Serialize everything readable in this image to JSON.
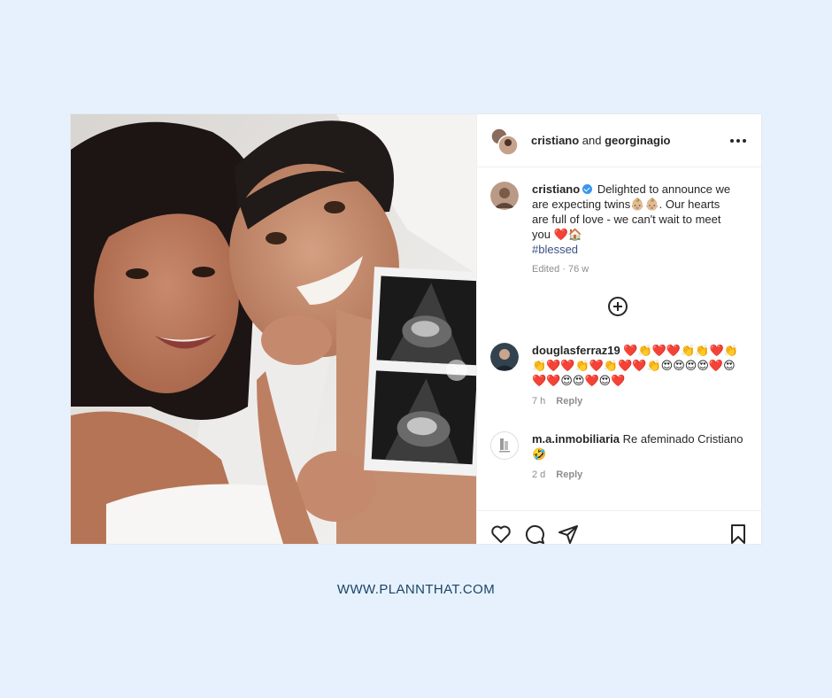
{
  "post": {
    "header": {
      "user1": "cristiano",
      "and": " and ",
      "user2": "georginagio"
    },
    "caption": {
      "username": "cristiano",
      "text": "Delighted to announce we are expecting twins👶🏼👶🏼. Our hearts are full of love - we can't wait to meet you ❤️🏠",
      "hashtag": "#blessed",
      "meta": "Edited · 76 w"
    },
    "comments": [
      {
        "username": "douglasferraz19",
        "text": "❤️👏❤️❤️👏👏❤️👏👏❤️❤️👏❤️👏❤️❤️👏😍😍😍😍❤️😍❤️❤️😍😍❤️😍❤️",
        "time": "7 h",
        "reply": "Reply"
      },
      {
        "username": "m.a.inmobiliaria",
        "text": "Re afeminado Cristiano 🤣",
        "time": "2 d",
        "reply": "Reply"
      }
    ]
  },
  "footer": {
    "url": "WWW.PLANNTHAT.COM"
  },
  "colors": {
    "background": "#e6f1fd",
    "footer_text": "#1c4466",
    "hashtag": "#385185",
    "verified": "#3897f0"
  },
  "icons": [
    "more-icon",
    "add-comment-icon",
    "like-icon",
    "comment-icon",
    "share-icon",
    "save-icon",
    "next-arrow-icon",
    "verified-badge-icon"
  ]
}
